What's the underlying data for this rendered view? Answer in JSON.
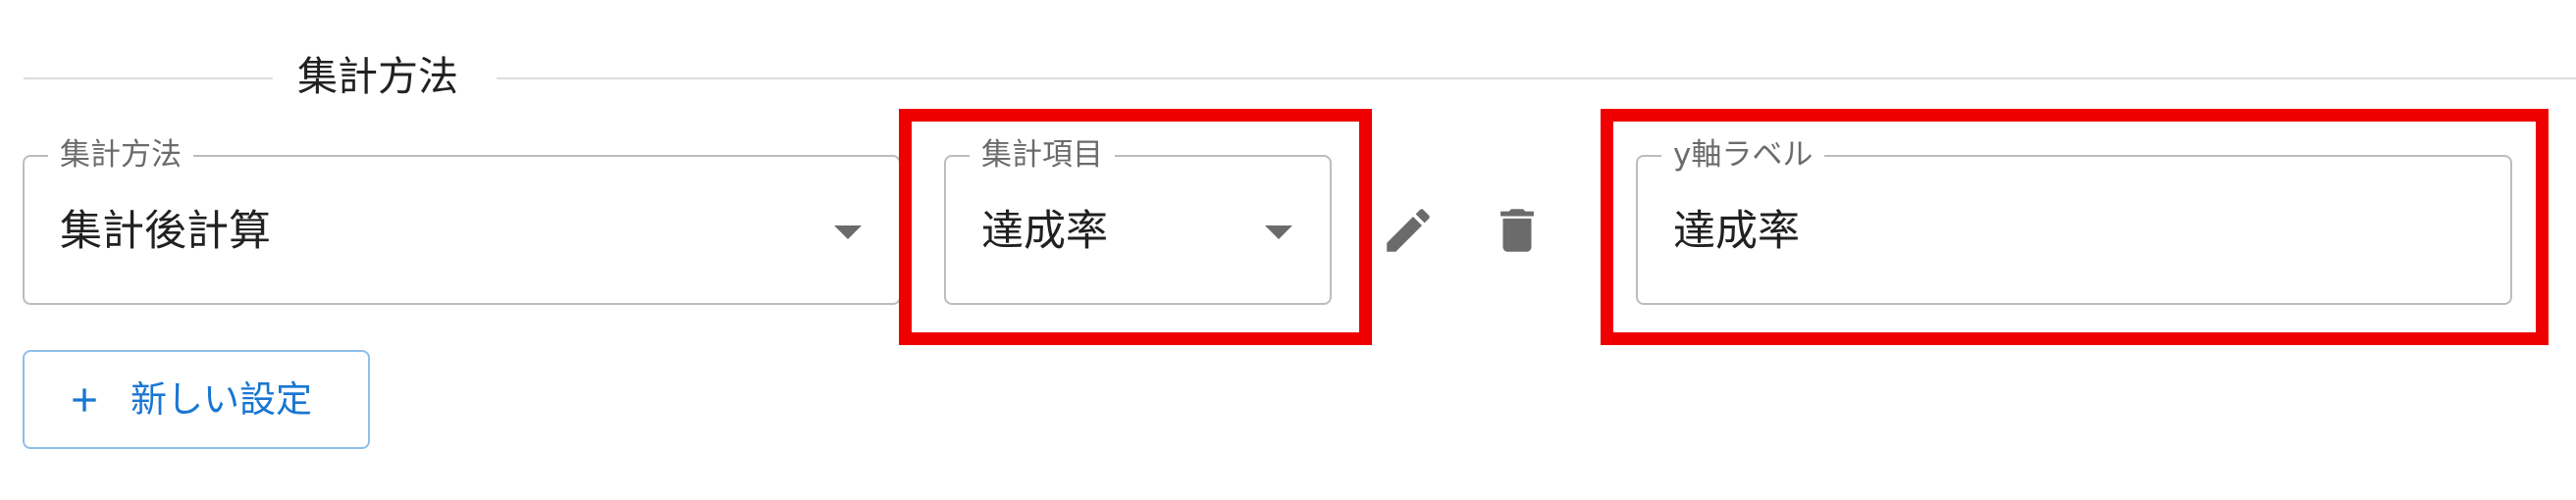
{
  "section": {
    "title": "集計方法"
  },
  "fields": {
    "method": {
      "label": "集計方法",
      "value": "集計後計算"
    },
    "item": {
      "label": "集計項目",
      "value": "達成率"
    },
    "ylabel": {
      "label": "y軸ラベル",
      "value": "達成率"
    }
  },
  "actions": {
    "edit_icon": "pencil-icon",
    "delete_icon": "trash-icon"
  },
  "add_button": {
    "icon": "plus-icon",
    "label": "新しい設定"
  },
  "colors": {
    "highlight": "#ee0000",
    "accent": "#1976d2",
    "icon": "#6b6b6b"
  }
}
